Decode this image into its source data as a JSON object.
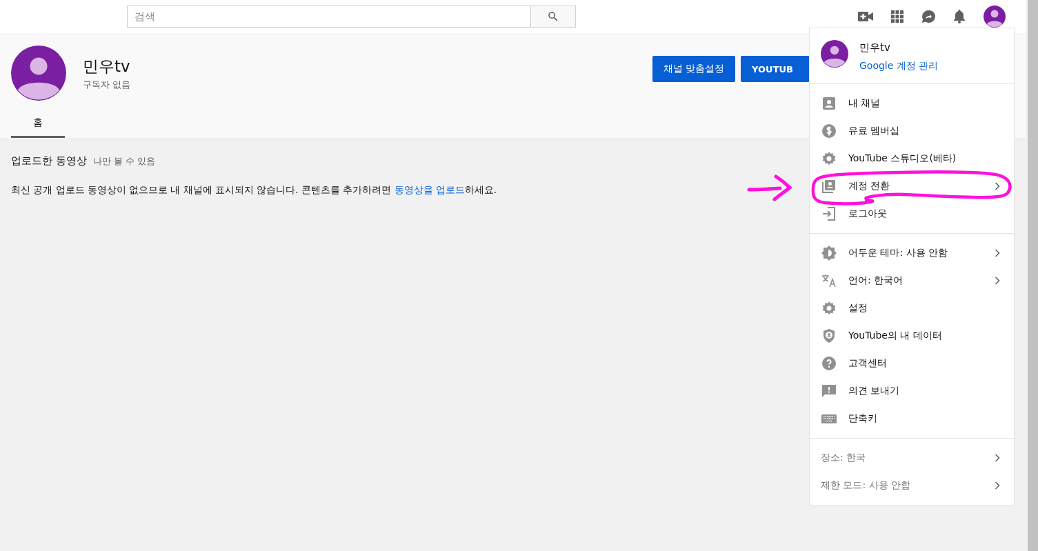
{
  "search": {
    "placeholder": "검색"
  },
  "channel": {
    "name": "민우tv",
    "subscribers": "구독자 없음",
    "buttons": [
      "채널 맞춤설정",
      "YOUTUB"
    ]
  },
  "tabs": [
    {
      "label": "홈",
      "selected": true
    }
  ],
  "uploads": {
    "title": "업로드한 동영상",
    "note": "나만 볼 수 있음",
    "message_before": "최신 공개 업로드 동영상이 없으므로 내 채널에 표시되지 않습니다. 콘텐츠를 추가하려면 ",
    "link": "동영상을 업로드",
    "message_after": "하세요."
  },
  "account_menu": {
    "name": "민우tv",
    "manage_link": "Google 계정 관리",
    "sections": [
      [
        {
          "label": "내 채널",
          "submenu": false
        },
        {
          "label": "유료 멤버십",
          "submenu": false
        },
        {
          "label": "YouTube 스튜디오(베타)",
          "submenu": false
        },
        {
          "label": "계정 전환",
          "submenu": true
        },
        {
          "label": "로그아웃",
          "submenu": false
        }
      ],
      [
        {
          "label": "어두운 테마: 사용 안함",
          "submenu": true
        },
        {
          "label": "언어: 한국어",
          "submenu": true
        },
        {
          "label": "설정",
          "submenu": false
        },
        {
          "label": "YouTube의 내 데이터",
          "submenu": false
        },
        {
          "label": "고객센터",
          "submenu": false
        },
        {
          "label": "의견 보내기",
          "submenu": false
        },
        {
          "label": "단축키",
          "submenu": false
        }
      ]
    ],
    "footer": [
      {
        "label": "장소: 한국",
        "submenu": true
      },
      {
        "label": "제한 모드: 사용 안함",
        "submenu": true
      }
    ]
  }
}
